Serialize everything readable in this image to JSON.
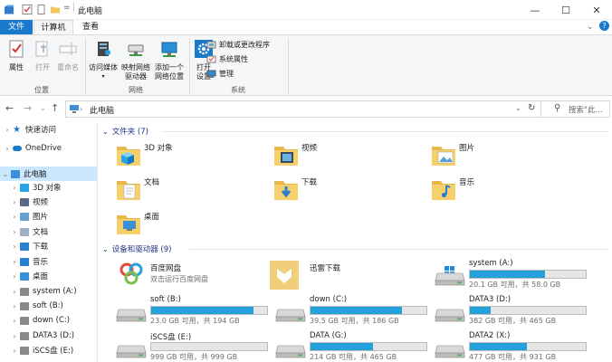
{
  "window": {
    "title": "此电脑"
  },
  "tabs": {
    "file": "文件",
    "computer": "计算机",
    "view": "查看"
  },
  "ribbon": {
    "location": {
      "label": "位置",
      "buttons": [
        {
          "label": "属性"
        },
        {
          "label": "打开"
        },
        {
          "label": "重命名"
        }
      ]
    },
    "network": {
      "label": "网络",
      "buttons": [
        {
          "label": "访问媒体"
        },
        {
          "label": "映射网络\n驱动器"
        },
        {
          "label": "添加一个\n网络位置"
        }
      ]
    },
    "system": {
      "label": "系统",
      "open_settings": "打开\n设置",
      "items": [
        {
          "label": "卸载或更改程序"
        },
        {
          "label": "系统属性"
        },
        {
          "label": "管理"
        }
      ]
    }
  },
  "address": {
    "path": "此电脑",
    "search_placeholder": "搜索\"此..."
  },
  "nav": {
    "items": [
      {
        "label": "快速访问",
        "icon": "star-icon",
        "color": "#1979ca"
      },
      {
        "label": "OneDrive",
        "icon": "cloud-icon",
        "color": "#1979ca"
      },
      {
        "label": "此电脑",
        "icon": "computer-icon",
        "color": "#3b8ed8",
        "selected": true
      },
      {
        "label": "3D 对象",
        "icon": "cube-icon",
        "color": "#2aa4e8"
      },
      {
        "label": "视频",
        "icon": "video-icon",
        "color": "#5a6a84"
      },
      {
        "label": "图片",
        "icon": "picture-icon",
        "color": "#6aa0cc"
      },
      {
        "label": "文档",
        "icon": "document-icon",
        "color": "#9fb0c4"
      },
      {
        "label": "下载",
        "icon": "download-icon",
        "color": "#2a7fd0"
      },
      {
        "label": "音乐",
        "icon": "music-icon",
        "color": "#2a7fd0"
      },
      {
        "label": "桌面",
        "icon": "desktop-icon",
        "color": "#3b8ed8"
      },
      {
        "label": "system (A:)",
        "icon": "drive-icon",
        "color": "#888"
      },
      {
        "label": "soft (B:)",
        "icon": "drive-icon",
        "color": "#888"
      },
      {
        "label": "down (C:)",
        "icon": "drive-icon",
        "color": "#888"
      },
      {
        "label": "DATA3 (D:)",
        "icon": "drive-icon",
        "color": "#888"
      },
      {
        "label": "iSCS盘 (E:)",
        "icon": "drive-icon",
        "color": "#888"
      }
    ]
  },
  "folders": {
    "header": "文件夹 (7)",
    "items": [
      {
        "name": "3D 对象",
        "icon": "cube-icon"
      },
      {
        "name": "视频",
        "icon": "video-icon"
      },
      {
        "name": "图片",
        "icon": "picture-icon"
      },
      {
        "name": "文档",
        "icon": "document-icon"
      },
      {
        "name": "下载",
        "icon": "download-icon"
      },
      {
        "name": "音乐",
        "icon": "music-icon"
      },
      {
        "name": "桌面",
        "icon": "desktop-icon"
      }
    ]
  },
  "devices": {
    "header": "设备和驱动器 (9)",
    "apps": [
      {
        "name": "百度网盘",
        "sub": "双击运行百度网盘",
        "icon": "baidu-netdisk-icon"
      },
      {
        "name": "迅雷下载",
        "sub": "",
        "icon": "xunlei-icon"
      }
    ],
    "drives": [
      {
        "name": "system (A:)",
        "free": "20.1 GB 可用，共 58.0 GB",
        "used": 0.65,
        "system": true
      },
      {
        "name": "soft (B:)",
        "free": "23.0 GB 可用，共 194 GB",
        "used": 0.88
      },
      {
        "name": "down (C:)",
        "free": "39.5 GB 可用，共 186 GB",
        "used": 0.79
      },
      {
        "name": "DATA3 (D:)",
        "free": "382 GB 可用，共 465 GB",
        "used": 0.18
      },
      {
        "name": "iSCS盘 (E:)",
        "free": "999 GB 可用，共 999 GB",
        "used": 0.0
      },
      {
        "name": "DATA (G:)",
        "free": "214 GB 可用，共 465 GB",
        "used": 0.54
      },
      {
        "name": "DATA2 (X:)",
        "free": "477 GB 可用，共 931 GB",
        "used": 0.49
      }
    ]
  }
}
